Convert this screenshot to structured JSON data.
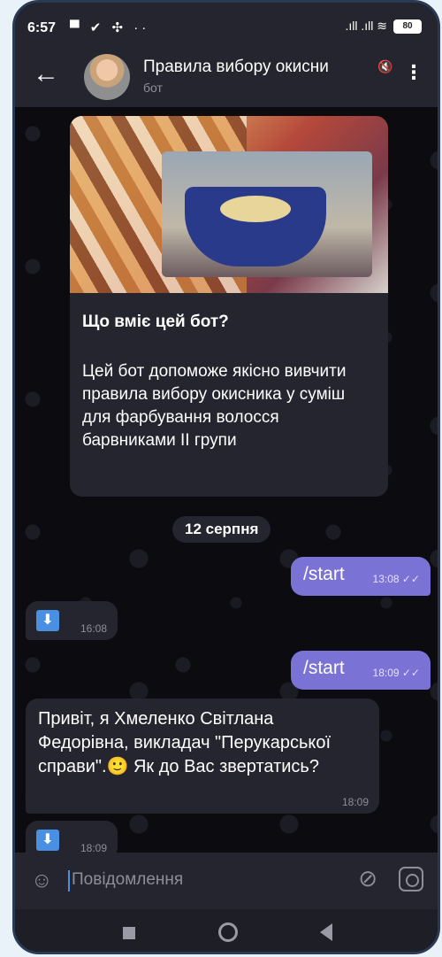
{
  "status": {
    "time": "6:57",
    "left_icons": "▀ ✔ ✣ ··",
    "right_icons": ".ıll .ıll ≋",
    "battery": "80"
  },
  "header": {
    "title": "Правила вибору окисни",
    "subtitle": "бот",
    "menu": "⋮",
    "mute": "🔇"
  },
  "card": {
    "title": "Що вміє цей бот?",
    "text": "Цей бот допоможе якісно вивчити правила вибору окисника у суміш для фарбування волосся барвниками II групи"
  },
  "date_pill": "12 серпня",
  "messages": [
    {
      "text": "/start",
      "time": "13:08 ✓✓"
    },
    {
      "icon": "⬇",
      "time": "16:08"
    },
    {
      "text": "/start",
      "time": "18:09 ✓✓"
    },
    {
      "text": "Привіт, я Хмеленко Світлана Федорівна, викладач \"Перукарської справи\".🙂 Як до Вас звертатись?",
      "time": "18:09"
    },
    {
      "icon": "⬇",
      "time": "18:09"
    }
  ],
  "composer": {
    "placeholder": "Повідомлення"
  }
}
